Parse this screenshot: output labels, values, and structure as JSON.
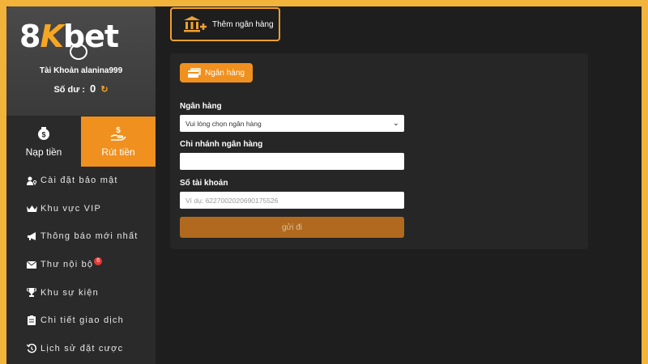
{
  "brand": {
    "logo_prefix": "8",
    "logo_k": "K",
    "logo_suffix": "bet"
  },
  "account": {
    "label": "Tài Khoản",
    "username": "alanina999",
    "balance_label": "Số dư :",
    "balance_value": "0"
  },
  "tabs": {
    "deposit": "Nạp tiền",
    "withdraw": "Rút tiền"
  },
  "menu": [
    {
      "label": "Cài đặt bảo mật",
      "icon": "user-key-icon"
    },
    {
      "label": "Khu vực VIP",
      "icon": "crown-icon"
    },
    {
      "label": "Thông báo mới nhất",
      "icon": "megaphone-icon"
    },
    {
      "label": "Thư nội bộ",
      "icon": "envelope-icon",
      "badge": "6"
    },
    {
      "label": "Khu sự kiện",
      "icon": "trophy-icon"
    },
    {
      "label": "Chi tiết giao dịch",
      "icon": "clipboard-icon"
    },
    {
      "label": "Lịch sử đặt cược",
      "icon": "history-icon"
    }
  ],
  "add_bank": {
    "label": "Thêm ngân hàng"
  },
  "form": {
    "tab_label": "Ngân hàng",
    "bank_label": "Ngân hàng",
    "bank_select_value": "Vui lòng chọn ngân hàng",
    "branch_label": "Chi nhánh ngân hàng",
    "branch_value": "",
    "account_label": "Số tài khoản",
    "account_placeholder": "Ví dụ: 6227002020690175526",
    "submit_label": "gửi đi"
  },
  "colors": {
    "accent": "#f0901e",
    "background": "#1e1e1e",
    "border": "#f2b33a",
    "badge": "#e53935"
  }
}
